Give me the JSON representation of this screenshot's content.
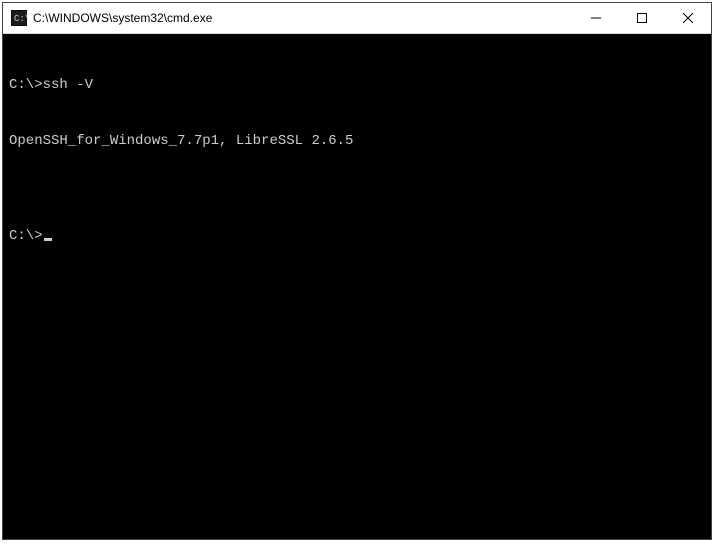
{
  "titlebar": {
    "title": "C:\\WINDOWS\\system32\\cmd.exe"
  },
  "terminal": {
    "line1_prompt": "C:\\>",
    "line1_cmd": "ssh -V",
    "line2": "OpenSSH_for_Windows_7.7p1, LibreSSL 2.6.5",
    "line3_blank": "",
    "line4_prompt": "C:\\>"
  }
}
